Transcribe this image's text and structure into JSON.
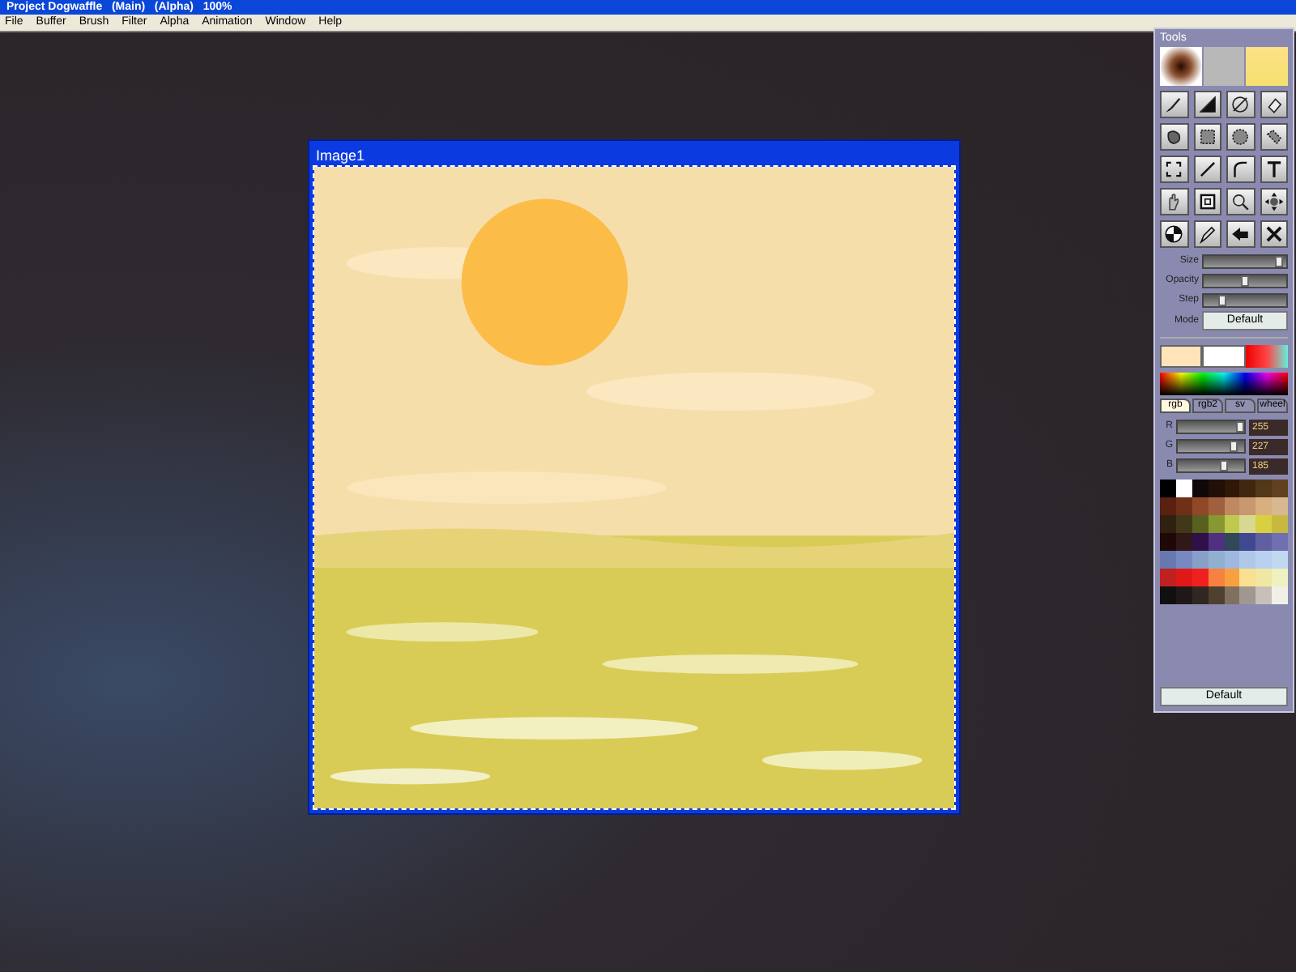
{
  "window": {
    "title": "Project Dogwaffle   (Main)   (Alpha)   100%"
  },
  "menu": [
    "File",
    "Buffer",
    "Brush",
    "Filter",
    "Alpha",
    "Animation",
    "Window",
    "Help"
  ],
  "image_window": {
    "title": "Image1"
  },
  "tools_panel": {
    "title": "Tools",
    "sliders": [
      {
        "label": "Size",
        "level": 0.95
      },
      {
        "label": "Opacity",
        "level": 0.5
      },
      {
        "label": "Step",
        "level": 0.2
      }
    ],
    "mode": {
      "label": "Mode",
      "value": "Default"
    },
    "color_slots": [
      {
        "color": "#ffe3b9"
      },
      {
        "color": "#ffffff"
      }
    ],
    "color_tabs": [
      {
        "label": "rgb",
        "selected": true
      },
      {
        "label": "rgb2",
        "selected": false
      },
      {
        "label": "sv",
        "selected": false
      },
      {
        "label": "wheel",
        "selected": false
      }
    ],
    "channels": [
      {
        "label": "R",
        "level": 1.0,
        "value": "255"
      },
      {
        "label": "G",
        "level": 0.89,
        "value": "227"
      },
      {
        "label": "B",
        "level": 0.73,
        "value": "185"
      }
    ],
    "palette": [
      {
        "color": "#000000"
      },
      {
        "color": "#ffffff"
      },
      {
        "color": "#100808"
      },
      {
        "color": "#201008"
      },
      {
        "color": "#301808"
      },
      {
        "color": "#402810"
      },
      {
        "color": "#503818"
      },
      {
        "color": "#604020"
      },
      {
        "color": "#5a2010"
      },
      {
        "color": "#703018"
      },
      {
        "color": "#904828"
      },
      {
        "color": "#a06040"
      },
      {
        "color": "#c08860"
      },
      {
        "color": "#c89870"
      },
      {
        "color": "#d8b080"
      },
      {
        "color": "#d8b890"
      },
      {
        "color": "#302010"
      },
      {
        "color": "#403818"
      },
      {
        "color": "#586020"
      },
      {
        "color": "#889830"
      },
      {
        "color": "#c0c850"
      },
      {
        "color": "#d8d890"
      },
      {
        "color": "#d8d040"
      },
      {
        "color": "#c8b840"
      },
      {
        "color": "#200808"
      },
      {
        "color": "#301818"
      },
      {
        "color": "#301048"
      },
      {
        "color": "#503080"
      },
      {
        "color": "#304858"
      },
      {
        "color": "#404890"
      },
      {
        "color": "#6060a0"
      },
      {
        "color": "#7070b0"
      },
      {
        "color": "#6878b0"
      },
      {
        "color": "#7888c0"
      },
      {
        "color": "#88a0c8"
      },
      {
        "color": "#90b0d0"
      },
      {
        "color": "#a0b8e0"
      },
      {
        "color": "#b0c8e8"
      },
      {
        "color": "#b8d0f0"
      },
      {
        "color": "#c0d8f0"
      },
      {
        "color": "#c02020"
      },
      {
        "color": "#e01818"
      },
      {
        "color": "#f02020"
      },
      {
        "color": "#f88040"
      },
      {
        "color": "#f8a040"
      },
      {
        "color": "#f8e090"
      },
      {
        "color": "#f0e8a0"
      },
      {
        "color": "#f0f0c0"
      },
      {
        "color": "#101010"
      },
      {
        "color": "#201818"
      },
      {
        "color": "#302820"
      },
      {
        "color": "#504030"
      },
      {
        "color": "#807060"
      },
      {
        "color": "#a09890"
      },
      {
        "color": "#c8c0b8"
      },
      {
        "color": "#f0f0e8"
      }
    ],
    "default_button": "Default"
  }
}
